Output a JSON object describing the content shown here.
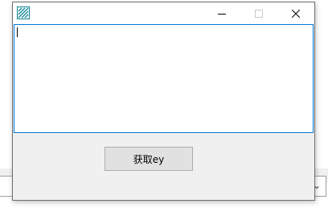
{
  "window": {
    "title": "",
    "controls": {
      "minimize_icon": "minimize-icon",
      "maximize_icon": "maximize-icon",
      "close_icon": "close-icon"
    }
  },
  "main": {
    "text_area_value": "",
    "get_button_label": "获取ey"
  },
  "background": {
    "combo_arrow": "⌄"
  },
  "colors": {
    "focus_border": "#0078d7",
    "window_bg": "#f0f0f0",
    "button_bg": "#e1e1e1",
    "app_icon": "#1a8a9a"
  }
}
